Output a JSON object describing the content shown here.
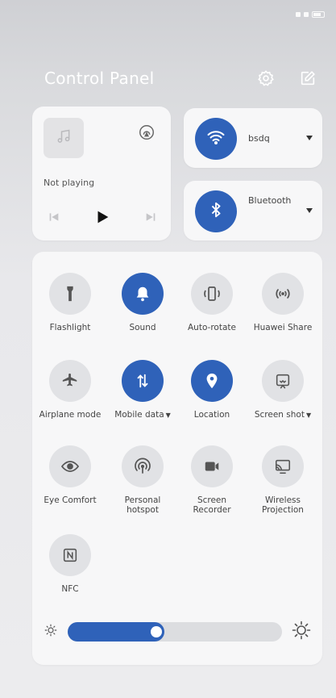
{
  "status_bar": {
    "line1": "",
    "line2": ""
  },
  "header": {
    "title": "Control Panel",
    "settings_icon": "gear-icon",
    "edit_icon": "edit-icon"
  },
  "media": {
    "status": "Not playing",
    "icons": [
      "music-note-icon",
      "cast-icon",
      "previous-icon",
      "play-icon",
      "next-icon"
    ]
  },
  "wifi": {
    "label": "bsdq",
    "icon": "wifi-icon"
  },
  "bluetooth": {
    "label": "Bluetooth",
    "icon": "bluetooth-icon"
  },
  "toggles": [
    {
      "id": "flashlight",
      "label": "Flashlight",
      "icon": "flashlight-icon",
      "on": false
    },
    {
      "id": "sound",
      "label": "Sound",
      "icon": "bell-icon",
      "on": true
    },
    {
      "id": "auto-rotate",
      "label": "Auto-rotate",
      "icon": "rotate-icon",
      "on": false
    },
    {
      "id": "huawei-share",
      "label": "Huawei Share",
      "icon": "share-wave-icon",
      "on": false
    },
    {
      "id": "airplane",
      "label": "Airplane mode",
      "icon": "airplane-icon",
      "on": false
    },
    {
      "id": "mobile-data",
      "label": "Mobile data",
      "icon": "data-arrows-icon",
      "on": true,
      "dropdown": true
    },
    {
      "id": "location",
      "label": "Location",
      "icon": "location-pin-icon",
      "on": true
    },
    {
      "id": "screenshot",
      "label": "Screen shot",
      "icon": "screenshot-icon",
      "on": false,
      "dropdown": true
    },
    {
      "id": "eye-comfort",
      "label": "Eye Comfort",
      "icon": "eye-icon",
      "on": false
    },
    {
      "id": "hotspot",
      "label": "Personal hotspot",
      "icon": "hotspot-icon",
      "on": false
    },
    {
      "id": "screen-recorder",
      "label": "Screen Recorder",
      "icon": "camera-icon",
      "on": false
    },
    {
      "id": "wireless-projection",
      "label": "Wireless Projection",
      "icon": "projection-icon",
      "on": false
    },
    {
      "id": "nfc",
      "label": "NFC",
      "icon": "nfc-icon",
      "on": false
    }
  ],
  "brightness": {
    "level": 0.45,
    "low_icon": "sun-small-icon",
    "high_icon": "sun-large-icon"
  },
  "colors": {
    "accent": "#2f62b9",
    "tile_off": "#e1e2e5",
    "card": "#f7f7f8"
  }
}
